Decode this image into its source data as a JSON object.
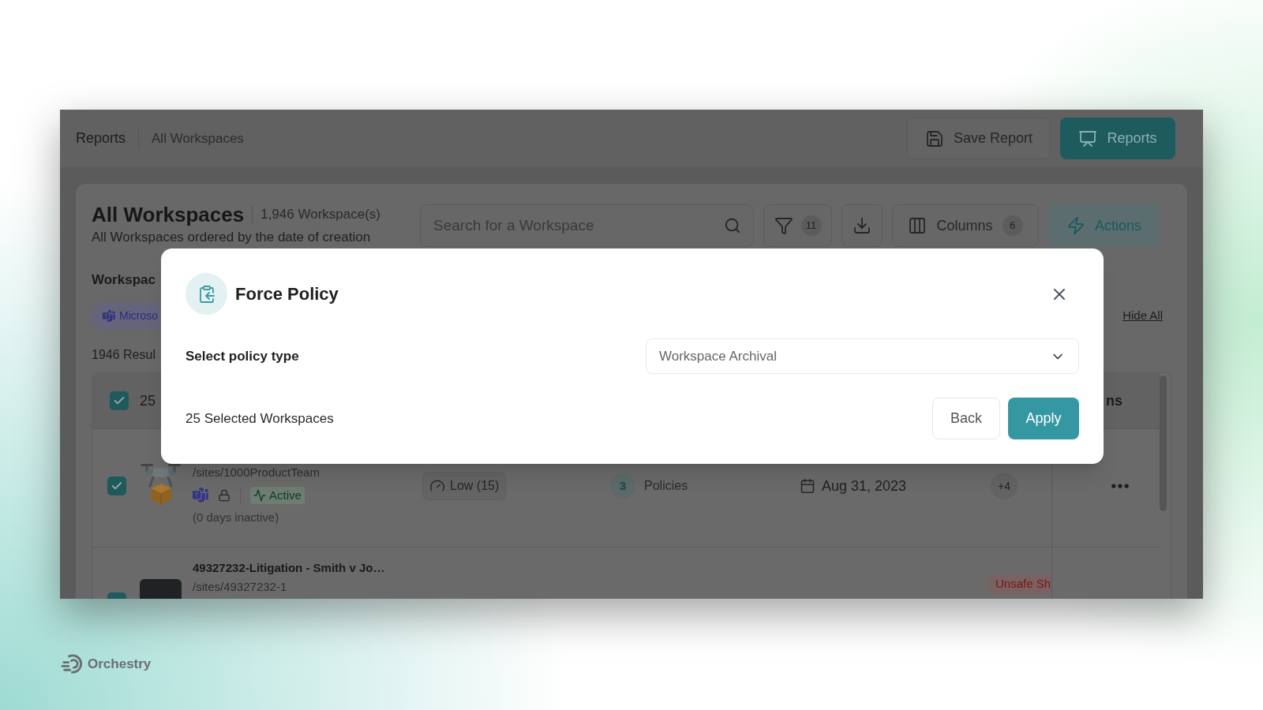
{
  "header": {
    "breadcrumbs": [
      {
        "label": "Reports"
      },
      {
        "label": "All Workspaces"
      }
    ],
    "buttons": [
      {
        "label": "Save Report",
        "kind": "secondary"
      },
      {
        "label": "Reports",
        "kind": "primary"
      }
    ]
  },
  "page": {
    "title": "All Workspaces",
    "count": "1,946 Workspace(s)",
    "subtitle": "All Workspaces ordered by the date of creation"
  },
  "toolbar": {
    "search": {
      "placeholder": "Search for a Workspace"
    },
    "filter_badge": "11",
    "columns": {
      "label": "Columns",
      "badge": "6"
    },
    "actions": {
      "label": "Actions"
    }
  },
  "filters": {
    "heading": "Workspac",
    "chips": [
      {
        "label": "Microso"
      }
    ],
    "hide_all": "Hide All"
  },
  "results": "1946 Resul",
  "table": {
    "header": {
      "checked": true,
      "selection": "25",
      "actions_column": "ns"
    },
    "rows": [
      {
        "kind": "illustration",
        "checked": true,
        "path": "/sites/1000ProductTeam",
        "locked": true,
        "status": "Active",
        "inactive": "(0 days inactive)",
        "risk": "Low (15)",
        "policies_count": "3",
        "policies_label": "Policies",
        "created": "Aug 31, 2023",
        "extra": "+4"
      },
      {
        "kind": "photo",
        "checked": true,
        "name": "49327232-Litigation - Smith v Jo…",
        "path": "/sites/49327232-1",
        "tag": "Unsafe Sh"
      }
    ]
  },
  "modal": {
    "title": "Force Policy",
    "field_label": "Select policy type",
    "select_value": "Workspace Archival",
    "selection_summary": "25 Selected Workspaces",
    "buttons": [
      {
        "label": "Back",
        "kind": "secondary"
      },
      {
        "label": "Apply",
        "kind": "primary"
      }
    ]
  },
  "brand": {
    "name": "Orchestry"
  }
}
